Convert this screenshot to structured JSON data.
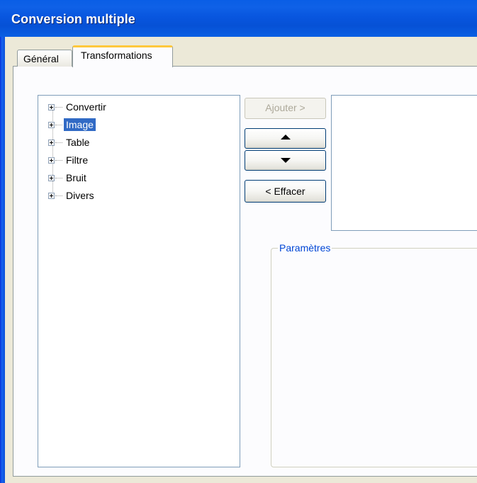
{
  "window": {
    "title": "Conversion multiple"
  },
  "tabs": [
    {
      "label": "Général",
      "selected": false
    },
    {
      "label": "Transformations",
      "selected": true
    }
  ],
  "tree": {
    "items": [
      {
        "label": "Convertir",
        "selected": false
      },
      {
        "label": "Image",
        "selected": true
      },
      {
        "label": "Table",
        "selected": false
      },
      {
        "label": "Filtre",
        "selected": false
      },
      {
        "label": "Bruit",
        "selected": false
      },
      {
        "label": "Divers",
        "selected": false
      }
    ]
  },
  "buttons": {
    "add_label": "Ajouter >",
    "add_enabled": false,
    "move_up_icon": "triangle-up-icon",
    "move_down_icon": "triangle-down-icon",
    "clear_label": "< Effacer"
  },
  "parameters": {
    "group_label": "Paramètres"
  },
  "colors": {
    "titlebar": "#0a5ee6",
    "selection": "#316ac5",
    "tab_highlight": "#ffc83c",
    "groupbox_label": "#0046d5"
  }
}
